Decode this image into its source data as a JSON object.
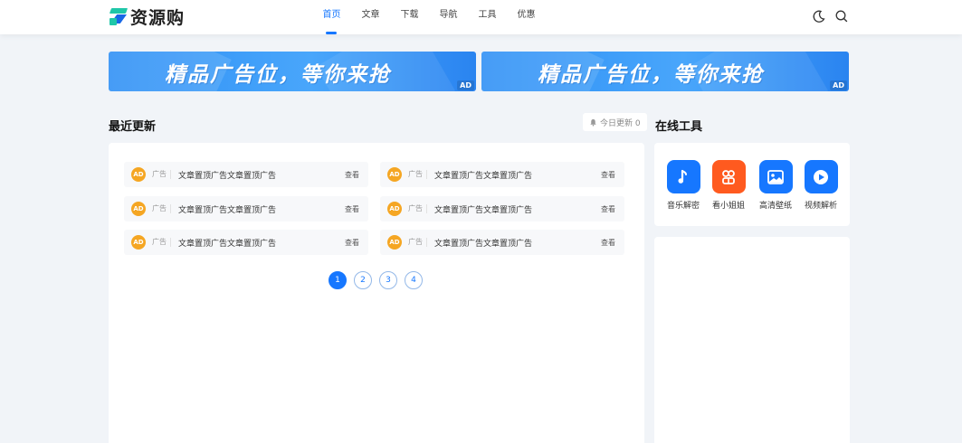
{
  "header": {
    "logo_text": "资源购",
    "nav": [
      "首页",
      "文章",
      "下载",
      "导航",
      "工具",
      "优惠"
    ],
    "active_nav": 0
  },
  "ads": [
    {
      "text": "精品广告位，等你来抢",
      "badge": "AD"
    },
    {
      "text": "精品广告位，等你来抢",
      "badge": "AD"
    }
  ],
  "recent": {
    "title": "最近更新",
    "today_label": "今日更新 0",
    "items": [
      {
        "avatar": "AD",
        "tag": "广告",
        "title": "文章置顶广告文章置顶广告",
        "action": "查看"
      },
      {
        "avatar": "AD",
        "tag": "广告",
        "title": "文章置顶广告文章置顶广告",
        "action": "查看"
      },
      {
        "avatar": "AD",
        "tag": "广告",
        "title": "文章置顶广告文章置顶广告",
        "action": "查看"
      },
      {
        "avatar": "AD",
        "tag": "广告",
        "title": "文章置顶广告文章置顶广告",
        "action": "查看"
      },
      {
        "avatar": "AD",
        "tag": "广告",
        "title": "文章置顶广告文章置顶广告",
        "action": "查看"
      },
      {
        "avatar": "AD",
        "tag": "广告",
        "title": "文章置顶广告文章置顶广告",
        "action": "查看"
      }
    ],
    "pages": [
      "1",
      "2",
      "3",
      "4"
    ],
    "active_page": 0
  },
  "tools": {
    "title": "在线工具",
    "items": [
      {
        "label": "音乐解密",
        "icon": "music-note-icon",
        "color": "#1677ff"
      },
      {
        "label": "看小姐姐",
        "icon": "people-icon",
        "color": "#ff5a1f"
      },
      {
        "label": "高清壁纸",
        "icon": "image-icon",
        "color": "#1677ff"
      },
      {
        "label": "视频解析",
        "icon": "play-icon",
        "color": "#1677ff"
      }
    ]
  },
  "colors": {
    "accent": "#1677ff",
    "ad_badge": "#f5a623"
  }
}
